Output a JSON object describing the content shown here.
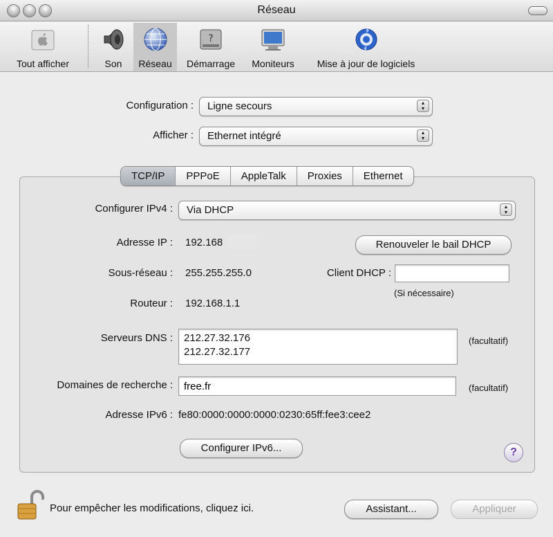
{
  "window": {
    "title": "Réseau"
  },
  "toolbar": {
    "items": [
      {
        "label": "Tout afficher",
        "icon": "apple-logo-icon"
      },
      {
        "label": "Son",
        "icon": "speaker-icon"
      },
      {
        "label": "Réseau",
        "icon": "globe-icon",
        "selected": true
      },
      {
        "label": "Démarrage",
        "icon": "hard-disk-icon"
      },
      {
        "label": "Moniteurs",
        "icon": "monitor-icon"
      },
      {
        "label": "Mise à jour de logiciels",
        "icon": "software-update-icon"
      }
    ]
  },
  "top": {
    "configuration_label": "Configuration :",
    "configuration_value": "Ligne secours",
    "afficher_label": "Afficher :",
    "afficher_value": "Ethernet intégré"
  },
  "tabs": [
    {
      "label": "TCP/IP",
      "selected": true
    },
    {
      "label": "PPPoE"
    },
    {
      "label": "AppleTalk"
    },
    {
      "label": "Proxies"
    },
    {
      "label": "Ethernet"
    }
  ],
  "tcpip": {
    "ipv4_label": "Configurer IPv4 :",
    "ipv4_value": "Via DHCP",
    "ip_label": "Adresse IP :",
    "ip_value": "192.168",
    "renew_button": "Renouveler le bail DHCP",
    "subnet_label": "Sous-réseau :",
    "subnet_value": "255.255.255.0",
    "dhcp_client_label": "Client DHCP :",
    "dhcp_client_value": "",
    "dhcp_hint": "(Si nécessaire)",
    "router_label": "Routeur :",
    "router_value": "192.168.1.1",
    "dns_label": "Serveurs DNS :",
    "dns_values": [
      "212.27.32.176",
      "212.27.32.177"
    ],
    "optional_hint": "(facultatif)",
    "search_label": "Domaines de recherche :",
    "search_value": "free.fr",
    "ipv6_label": "Adresse IPv6 :",
    "ipv6_value": "fe80:0000:0000:0000:0230:65ff:fee3:cee2",
    "ipv6_button": "Configurer IPv6...",
    "help_glyph": "?"
  },
  "bottom": {
    "lock_text": "Pour empêcher les modifications, cliquez ici.",
    "assistant_button": "Assistant...",
    "apply_button": "Appliquer"
  }
}
